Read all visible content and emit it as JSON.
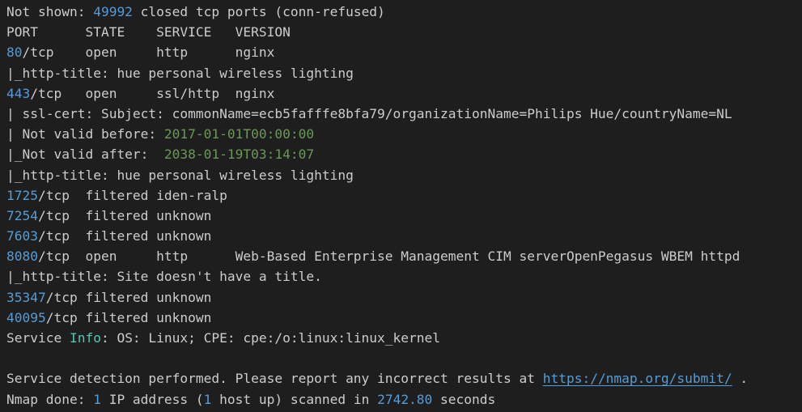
{
  "colors": {
    "background": "#1e1e1e",
    "text": "#cccccc",
    "number": "#569cd6",
    "date": "#6a9955",
    "keyword": "#4ec9b0",
    "link": "#569cd6"
  },
  "lines": [
    [
      {
        "t": "Not shown: "
      },
      {
        "t": "49992",
        "c": "num"
      },
      {
        "t": " closed tcp ports (conn-refused)"
      }
    ],
    [
      {
        "t": "PORT      STATE    SERVICE   VERSION"
      }
    ],
    [
      {
        "t": "80",
        "c": "num"
      },
      {
        "t": "/tcp    open     http      nginx"
      }
    ],
    [
      {
        "t": "|_http-title: hue personal wireless lighting"
      }
    ],
    [
      {
        "t": "443",
        "c": "num"
      },
      {
        "t": "/tcp   open     ssl/http  nginx"
      }
    ],
    [
      {
        "t": "| ssl-cert: Subject: commonName=ecb5fafffe8bfa79/organizationName=Philips Hue/countryName=NL"
      }
    ],
    [
      {
        "t": "| Not valid before: "
      },
      {
        "t": "2017-01-01T00:00:00",
        "c": "date"
      }
    ],
    [
      {
        "t": "|_Not valid after:  "
      },
      {
        "t": "2038-01-19T03:14:07",
        "c": "date"
      }
    ],
    [
      {
        "t": "|_http-title: hue personal wireless lighting"
      }
    ],
    [
      {
        "t": "1725",
        "c": "num"
      },
      {
        "t": "/tcp  filtered iden-ralp"
      }
    ],
    [
      {
        "t": "7254",
        "c": "num"
      },
      {
        "t": "/tcp  filtered unknown"
      }
    ],
    [
      {
        "t": "7603",
        "c": "num"
      },
      {
        "t": "/tcp  filtered unknown"
      }
    ],
    [
      {
        "t": "8080",
        "c": "num"
      },
      {
        "t": "/tcp  open     http      Web-Based Enterprise Management CIM serverOpenPegasus WBEM httpd"
      }
    ],
    [
      {
        "t": "|_http-title: Site doesn't have a title."
      }
    ],
    [
      {
        "t": "35347",
        "c": "num"
      },
      {
        "t": "/tcp filtered unknown"
      }
    ],
    [
      {
        "t": "40095",
        "c": "num"
      },
      {
        "t": "/tcp filtered unknown"
      }
    ],
    [
      {
        "t": "Service "
      },
      {
        "t": "Info",
        "c": "kw"
      },
      {
        "t": ": OS: Linux; CPE: cpe:/o:linux:linux_kernel"
      }
    ],
    [
      {
        "t": ""
      }
    ],
    [
      {
        "t": "Service detection performed. Please report any incorrect results at "
      },
      {
        "t": "https://nmap.org/submit/",
        "c": "link"
      },
      {
        "t": " ."
      }
    ],
    [
      {
        "t": "Nmap done: "
      },
      {
        "t": "1",
        "c": "num"
      },
      {
        "t": " IP address ("
      },
      {
        "t": "1",
        "c": "num"
      },
      {
        "t": " host up) scanned in "
      },
      {
        "t": "2742.80",
        "c": "num"
      },
      {
        "t": " seconds"
      }
    ]
  ]
}
